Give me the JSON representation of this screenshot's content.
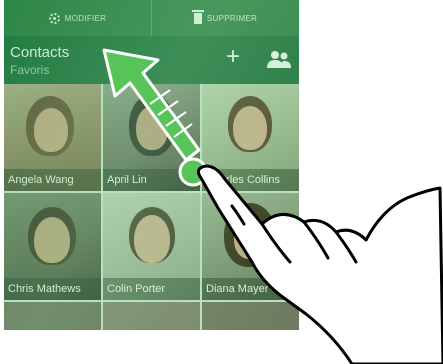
{
  "actionbar": {
    "edit_label": "MODIFIER",
    "delete_label": "SUPPRIMER"
  },
  "header": {
    "title": "Contacts",
    "subtitle": "Favoris",
    "add_symbol": "+"
  },
  "contacts": [
    {
      "name": "Angela Wang"
    },
    {
      "name": "April Lin"
    },
    {
      "name": "Charles Collins"
    },
    {
      "name": "Chris Mathews"
    },
    {
      "name": "Colin Porter"
    },
    {
      "name": "Diana Mayer"
    }
  ],
  "colors": {
    "actionbar": "#2f7a44",
    "header": "#1f6a3c",
    "gesture_arrow": "#57c45a"
  },
  "icons": [
    "gear-icon",
    "trash-icon",
    "plus-icon",
    "people-icon",
    "swipe-arrow-icon",
    "hand-pointer-icon"
  ]
}
